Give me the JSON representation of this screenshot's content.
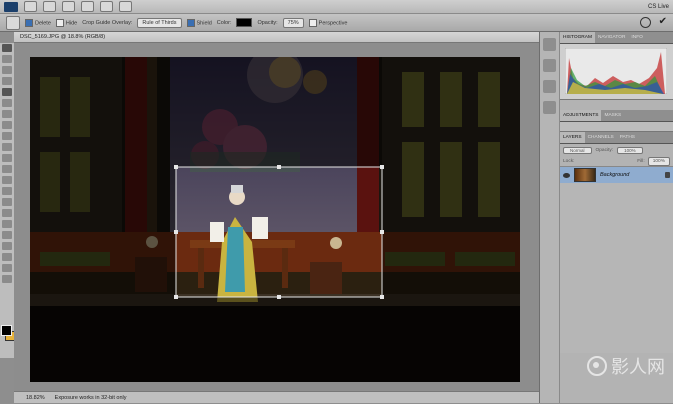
{
  "app_bar": {
    "cs_live": "CS Live"
  },
  "options_bar": {
    "delete_cropped": "Delete",
    "hide_cropped": "Hide",
    "crop_guide_label": "Crop Guide Overlay:",
    "crop_guide_value": "Rule of Thirds",
    "shield_label": "Shield",
    "color_label": "Color:",
    "opacity_label": "Opacity:",
    "opacity_value": "75%",
    "perspective_label": "Perspective",
    "shield_color": "#000000"
  },
  "document": {
    "tab_title": "DSC_5169.JPG @ 18.8% (RGB/8)"
  },
  "status_bar": {
    "zoom": "18.82%",
    "info": "Exposure works in 32-bit only"
  },
  "panels": {
    "top_tabs": [
      "HISTOGRAM",
      "NAVIGATOR",
      "INFO"
    ],
    "adjust_tabs": [
      "ADJUSTMENTS",
      "MASKS"
    ],
    "layers_tabs": [
      "LAYERS",
      "CHANNELS",
      "PATHS"
    ],
    "blend_mode": "Normal",
    "opacity_label": "Opacity:",
    "opacity_value": "100%",
    "lock_label": "Lock:",
    "fill_label": "Fill:",
    "fill_value": "100%",
    "layer_name": "Background"
  },
  "watermark": {
    "text": "影人网"
  }
}
